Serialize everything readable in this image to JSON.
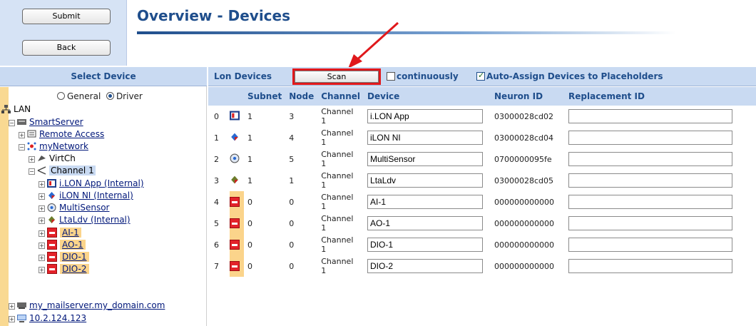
{
  "header": {
    "submit_label": "Submit",
    "back_label": "Back",
    "title": "Overview - Devices"
  },
  "left_panel": {
    "heading": "Select Device",
    "radio_general": "General",
    "radio_driver": "Driver",
    "tree": {
      "lan": "LAN",
      "smartserver": "SmartServer",
      "remote_access": "Remote Access",
      "mynetwork": "myNetwork",
      "virtch": "VirtCh",
      "channel1": "Channel 1",
      "ilon_app": "i.LON App (Internal)",
      "ilon_ni": "iLON NI (Internal)",
      "multisensor": "MultiSensor",
      "ltaldv": "LtaLdv (Internal)",
      "ai1": "AI-1",
      "ao1": "AO-1",
      "dio1": "DIO-1",
      "dio2": "DIO-2",
      "mailserver": "my_mailserver.my_domain.com",
      "ip": "10.2.124.123"
    }
  },
  "toolbar": {
    "label": "Lon Devices",
    "scan_label": "Scan",
    "continuously_label": "continuously",
    "continuously_checked": false,
    "auto_assign_label": "Auto-Assign Devices to Placeholders",
    "auto_assign_checked": true
  },
  "table": {
    "columns": [
      "Subnet",
      "Node",
      "Channel",
      "Device",
      "Neuron ID",
      "Replacement ID"
    ],
    "rows": [
      {
        "index": "0",
        "icon": "ilon-app-icon",
        "subnet": "1",
        "node": "3",
        "channel": "Channel 1",
        "device": "i.LON App",
        "neuron_id": "03000028cd02",
        "placeholder": false
      },
      {
        "index": "1",
        "icon": "ilon-ni-icon",
        "subnet": "1",
        "node": "4",
        "channel": "Channel 1",
        "device": "iLON NI",
        "neuron_id": "03000028cd04",
        "placeholder": false
      },
      {
        "index": "2",
        "icon": "multisensor-icon",
        "subnet": "1",
        "node": "5",
        "channel": "Channel 1",
        "device": "MultiSensor",
        "neuron_id": "0700000095fe",
        "placeholder": false
      },
      {
        "index": "3",
        "icon": "ltaldv-icon",
        "subnet": "1",
        "node": "1",
        "channel": "Channel 1",
        "device": "LtaLdv",
        "neuron_id": "03000028cd05",
        "placeholder": false
      },
      {
        "index": "4",
        "icon": "placeholder-device-icon",
        "subnet": "0",
        "node": "0",
        "channel": "Channel 1",
        "device": "AI-1",
        "neuron_id": "000000000000",
        "placeholder": true
      },
      {
        "index": "5",
        "icon": "placeholder-device-icon",
        "subnet": "0",
        "node": "0",
        "channel": "Channel 1",
        "device": "AO-1",
        "neuron_id": "000000000000",
        "placeholder": true
      },
      {
        "index": "6",
        "icon": "placeholder-device-icon",
        "subnet": "0",
        "node": "0",
        "channel": "Channel 1",
        "device": "DIO-1",
        "neuron_id": "000000000000",
        "placeholder": true
      },
      {
        "index": "7",
        "icon": "placeholder-device-icon",
        "subnet": "0",
        "node": "0",
        "channel": "Channel 1",
        "device": "DIO-2",
        "neuron_id": "000000000000",
        "placeholder": true
      }
    ]
  },
  "colors": {
    "accent": "#1f4e8c",
    "header_bg": "#c9daf2",
    "highlight": "#fbd48b",
    "callout_red": "#e0181b"
  }
}
